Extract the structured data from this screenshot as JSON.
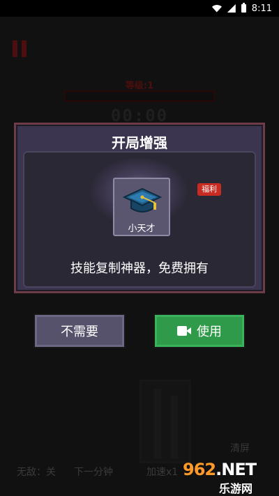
{
  "status_bar": {
    "time": "8:11"
  },
  "game": {
    "level_label": "等级:1",
    "timer": "00:00",
    "clear_label": "清屏",
    "invincible_label": "无敌：关",
    "next_minute_label": "下一分钟",
    "speed_label": "加速x1"
  },
  "dialog": {
    "title": "开局增强",
    "item": {
      "name": "小天才",
      "icon": "graduation-cap-icon"
    },
    "badge": "福利",
    "description": "技能复制神器，免费拥有",
    "buttons": {
      "decline": "不需要",
      "use": "使用"
    }
  },
  "watermark": {
    "logo_num": "962",
    "logo_suffix": ".NET",
    "sub": "乐游网"
  },
  "colors": {
    "dialog_bg": "#3b3550",
    "dialog_border": "#6d3c48",
    "use_button": "#2e9a4a",
    "badge": "#c72b22",
    "level_text": "#8a1a1a"
  }
}
